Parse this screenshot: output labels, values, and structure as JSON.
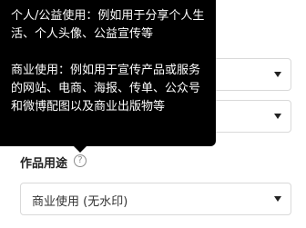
{
  "form": {
    "usage_label": "作品用途",
    "usage_select_value": "商业使用 (无水印)",
    "help_icon_glyph": "?"
  },
  "tooltip": {
    "personal_text": "个人/公益使用：例如用于分享个人生活、个人头像、公益宣传等",
    "commercial_text": "商业使用：例如用于宣传产品或服务的网站、电商、海报、传单、公众号和微博配图以及商业出版物等"
  },
  "icons": {
    "dropdown": "chevron-down-icon",
    "help": "question-circle-icon"
  },
  "colors": {
    "tooltip_bg": "#000000",
    "border": "#d9d9d9"
  }
}
